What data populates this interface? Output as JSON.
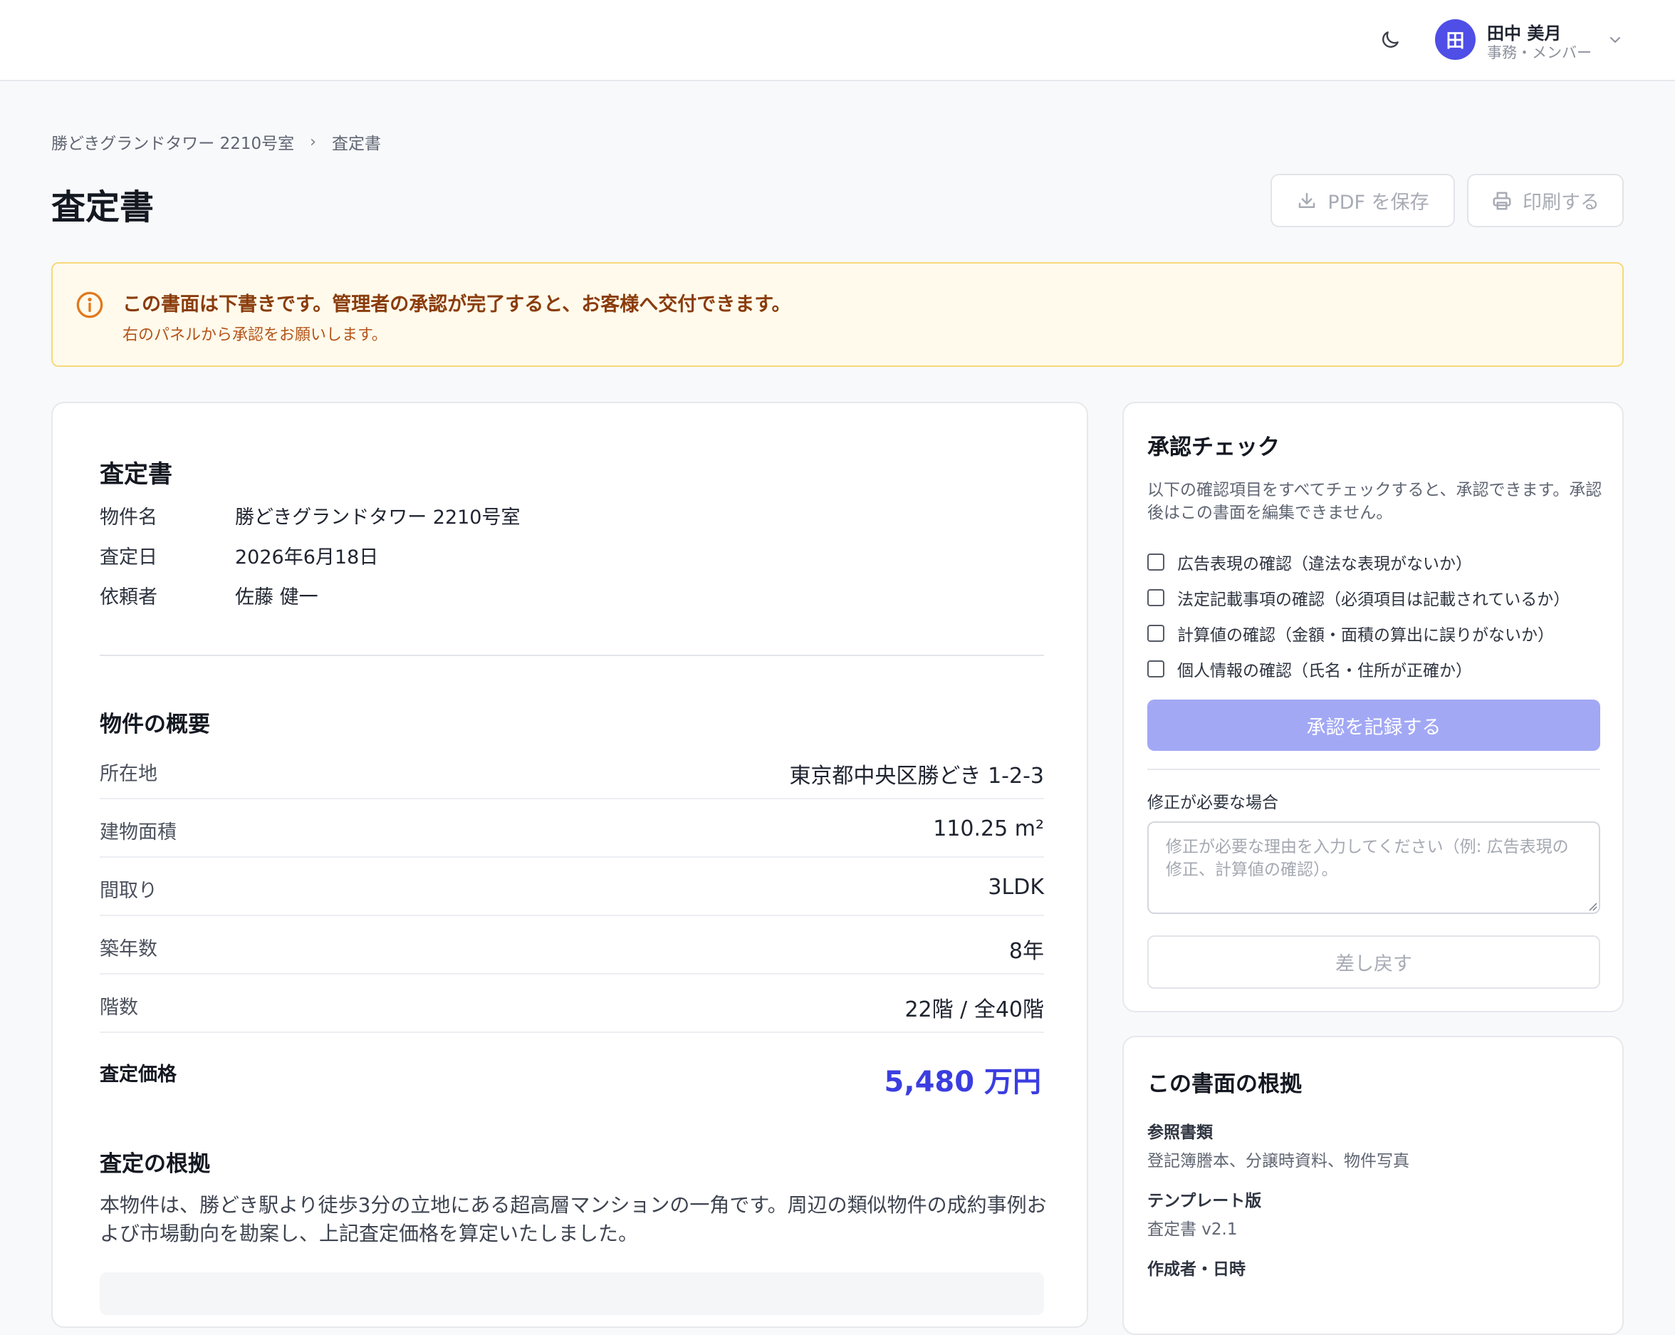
{
  "header": {
    "theme_icon": "moon-icon",
    "user": {
      "avatar_initial": "田",
      "name": "田中 美月",
      "role": "事務・メンバー"
    },
    "menu_icon": "chevron-down-icon"
  },
  "breadcrumb": {
    "parent": "勝どきグランドタワー 2210号室",
    "separator": "›",
    "current": "査定書"
  },
  "page_title": "査定書",
  "actions": {
    "pdf_label": "PDF を保存",
    "print_label": "印刷する"
  },
  "alert": {
    "title": "この書面は下書きです。管理者の承認が完了すると、お客様へ交付できます。",
    "subtitle": "右のパネルから承認をお願いします。",
    "color": "#fffaeb"
  },
  "document": {
    "title": "査定書",
    "meta": [
      {
        "label": "物件名",
        "value": "勝どきグランドタワー 2210号室"
      },
      {
        "label": "査定日",
        "value": "2026年6月18日"
      },
      {
        "label": "依頼者",
        "value": "佐藤 健一"
      }
    ],
    "overview_title": "物件の概要",
    "specs": [
      {
        "label": "所在地",
        "value": "東京都中央区勝どき 1-2-3"
      },
      {
        "label": "建物面積",
        "value": "110.25 m²"
      },
      {
        "label": "間取り",
        "value": "3LDK"
      },
      {
        "label": "築年数",
        "value": "8年"
      },
      {
        "label": "階数",
        "value": "22階 / 全40階"
      }
    ],
    "price_label": "査定価格",
    "price_value": "5,480 万円",
    "basis_title": "査定の根拠",
    "basis_text": "本物件は、勝どき駅より徒歩3分の立地にある超高層マンションの一角です。周辺の類似物件の成約事例および市場動向を勘案し、上記査定価格を算定いたしました。"
  },
  "approval": {
    "title": "承認チェック",
    "description": "以下の確認項目をすべてチェックすると、承認できます。承認後はこの書面を編集できません。",
    "checks": [
      "広告表現の確認（違法な表現がないか）",
      "法定記載事項の確認（必須項目は記載されているか）",
      "計算値の確認（金額・面積の算出に誤りがないか）",
      "個人情報の確認（氏名・住所が正確か）"
    ],
    "approve_label": "承認を記録する",
    "fix_label": "修正が必要な場合",
    "reason_placeholder": "修正が必要な理由を入力してください（例: 広告表現の修正、計算値の確認）。",
    "return_label": "差し戻す"
  },
  "basis_panel": {
    "title": "この書面の根拠",
    "items": [
      {
        "label": "参照書類",
        "value": "登記簿謄本、分譲時資料、物件写真"
      },
      {
        "label": "テンプレート版",
        "value": "査定書 v2.1"
      },
      {
        "label": "作成者・日時",
        "value": ""
      }
    ]
  },
  "colors": {
    "accent": "#3b3ee0",
    "avatar": "#4f4ee6",
    "approve_disabled": "#a2a8f4"
  }
}
